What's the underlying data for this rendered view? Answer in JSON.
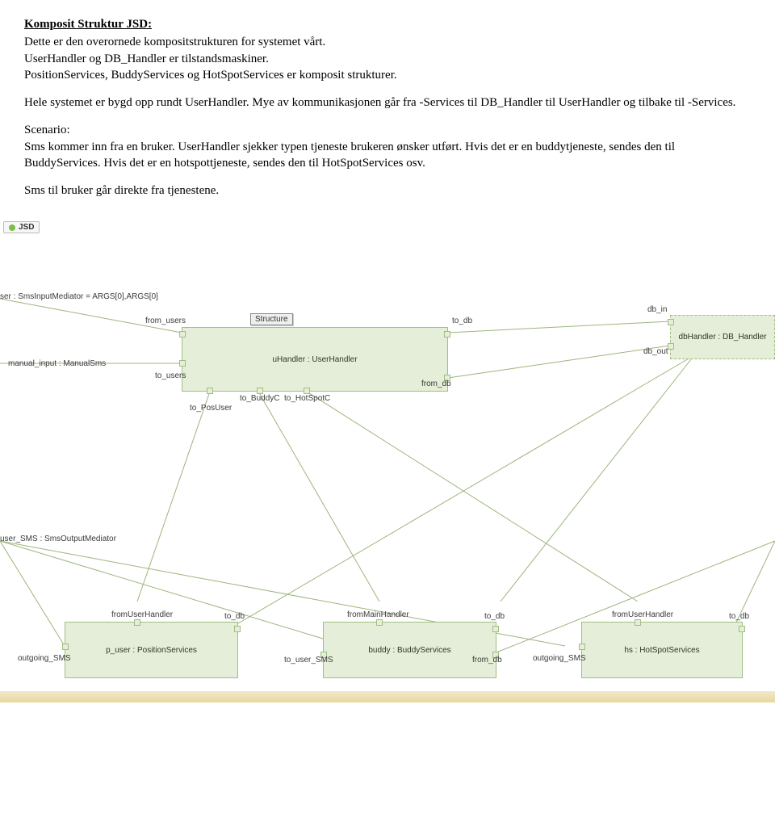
{
  "doc": {
    "title": "Komposit Struktur JSD:",
    "p1": "Dette er den overornede kompositstrukturen for systemet vårt.",
    "p2": "UserHandler og DB_Handler er tilstandsmaskiner.",
    "p3": "PositionServices, BuddyServices og HotSpotServices er komposit strukturer.",
    "p4": "Hele systemet er bygd opp rundt UserHandler. Mye av kommunikasjonen går fra -Services til DB_Handler til UserHandler og tilbake til -Services.",
    "p5": "Scenario:",
    "p6": "Sms kommer inn fra en bruker. UserHandler sjekker typen tjeneste brukeren ønsker utført. Hvis det er en buddytjeneste, sendes  den til BuddyServices. Hvis det er en hotspottjeneste, sendes den til HotSpotServices osv.",
    "p7": "Sms til bruker går direkte fra tjenestene."
  },
  "diagram": {
    "tab": "JSD",
    "button": "Structure",
    "ext_input": "ser : SmsInputMediator = ARGS[0],ARGS[0]",
    "manual_input": "manual_input : ManualSms",
    "ext_output": "user_SMS : SmsOutputMediator",
    "boxes": {
      "uhandler": "uHandler : UserHandler",
      "dbhandler": "dbHandler : DB_Handler",
      "puser": "p_user : PositionServices",
      "buddy": "buddy : BuddyServices",
      "hs": "hs : HotSpotServices"
    },
    "ports": {
      "from_users": "from_users",
      "to_db": "to_db",
      "to_users": "to_users",
      "from_db": "from_db",
      "to_posuser": "to_PosUser",
      "to_buddyc": "to_BuddyC",
      "to_hotspotc": "to_HotSpotC",
      "db_in": "db_in",
      "db_out": "db_out",
      "fromuserhandler": "fromUserHandler",
      "frommainhandler": "fromMainHandler",
      "outgoing_sms": "outgoing_SMS",
      "to_user_sms": "to_user_SMS"
    }
  }
}
